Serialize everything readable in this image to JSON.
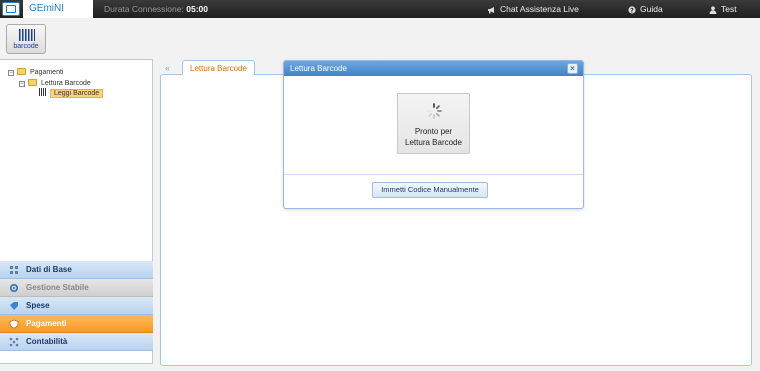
{
  "header": {
    "app_name": "GEmiNI",
    "connection_label": "Durata Connessione:",
    "connection_time": "05:00",
    "chat_label": "Chat Assistenza Live",
    "guide_label": "Guida",
    "user_label": "Test"
  },
  "toolbar": {
    "barcode_label": "barcode"
  },
  "tree": {
    "root": "Pagamenti",
    "child": "Lettura Barcode",
    "leaf": "Leggi Barcode",
    "expand_symbol": "⊟"
  },
  "accordion": [
    {
      "label": "Dati di Base",
      "icon": "grid-icon"
    },
    {
      "label": "Gestione Stabile",
      "icon": "gear-icon"
    },
    {
      "label": "Spese",
      "icon": "tag-icon"
    },
    {
      "label": "Pagamenti",
      "icon": "shield-icon"
    },
    {
      "label": "Contabilità",
      "icon": "nodes-icon"
    }
  ],
  "tabs": {
    "collapse_arrow": "«",
    "active_tab": "Lettura Barcode"
  },
  "dialog": {
    "title": "Lettura Barcode",
    "close_symbol": "×",
    "scan_line1": "Pronto per",
    "scan_line2": "Lettura Barcode",
    "manual_button": "Immetti Codice Manualmente"
  }
}
